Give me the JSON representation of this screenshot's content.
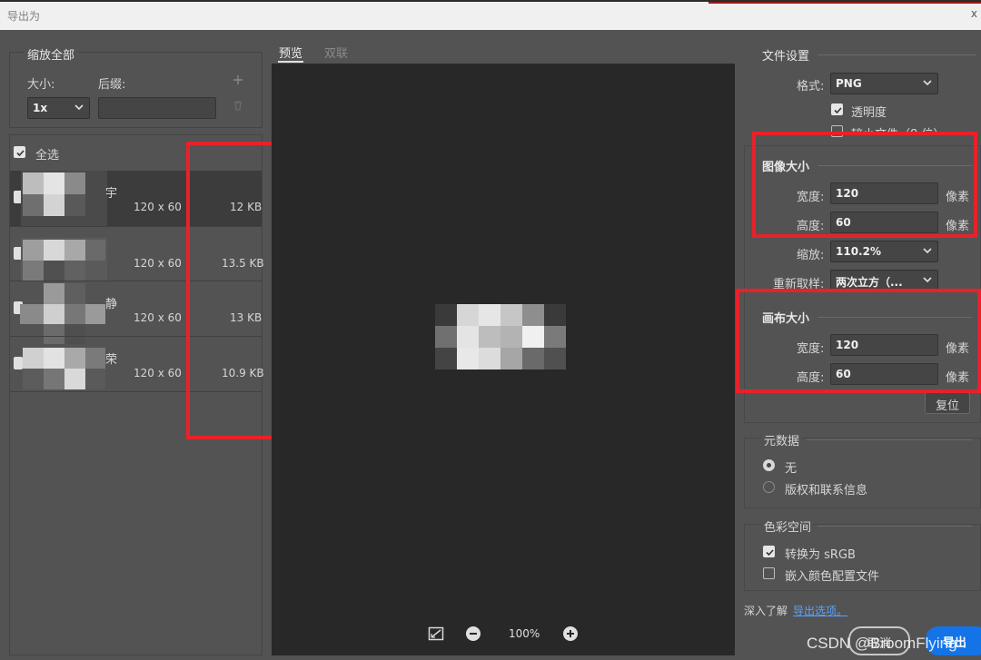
{
  "window": {
    "title": "导出为",
    "close_glyph": "x"
  },
  "left": {
    "scale_all_title": "缩放全部",
    "size_label": "大小:",
    "suffix_label": "后缀:",
    "size_value": "1x",
    "suffix_value": "",
    "select_all_label": "全选",
    "assets": [
      {
        "name_fragment": "宇",
        "dimensions": "120 x 60",
        "file_size": "12 KB",
        "checked": true
      },
      {
        "name_fragment": "",
        "dimensions": "120 x 60",
        "file_size": "13.5 KB",
        "checked": true
      },
      {
        "name_fragment": "静",
        "dimensions": "120 x 60",
        "file_size": "13 KB",
        "checked": true
      },
      {
        "name_fragment": "荣",
        "dimensions": "120 x 60",
        "file_size": "10.9 KB",
        "checked": true
      }
    ]
  },
  "center": {
    "tabs": [
      {
        "label": "预览",
        "active": true
      },
      {
        "label": "双联",
        "active": false
      }
    ],
    "zoom_level": "100%"
  },
  "right": {
    "file_settings": {
      "title": "文件设置",
      "format_label": "格式:",
      "format_value": "PNG",
      "transparency_label": "透明度",
      "transparency_checked": true,
      "smaller_file_label": "较小文件（8 位）",
      "smaller_file_checked": false
    },
    "image_size": {
      "title": "图像大小",
      "width_label": "宽度:",
      "width_value": "120",
      "height_label": "高度:",
      "height_value": "60",
      "unit": "像素",
      "scale_label": "缩放:",
      "scale_value": "110.2%",
      "resample_label": "重新取样:",
      "resample_value": "两次立方（..."
    },
    "canvas_size": {
      "title": "画布大小",
      "width_label": "宽度:",
      "width_value": "120",
      "height_label": "高度:",
      "height_value": "60",
      "unit": "像素",
      "reset_label": "复位"
    },
    "metadata": {
      "title": "元数据",
      "options": [
        {
          "label": "无",
          "selected": true
        },
        {
          "label": "版权和联系信息",
          "selected": false
        }
      ]
    },
    "color_space": {
      "title": "色彩空间",
      "convert_label": "转换为 sRGB",
      "convert_checked": true,
      "embed_label": "嵌入颜色配置文件",
      "embed_checked": false
    },
    "learn_more_label": "深入了解",
    "export_options_link": "导出选项。"
  },
  "footer": {
    "cancel_label": "取消",
    "export_label": "导出",
    "watermark": "CSDN @BroomFlying"
  },
  "colors": {
    "accent_blue": "#1473e6",
    "annotation_red": "#e8212b",
    "link": "#5aa2ff"
  }
}
